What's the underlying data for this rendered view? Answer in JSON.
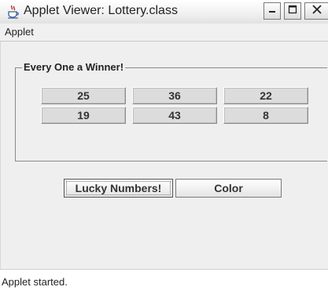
{
  "window": {
    "title": "Applet Viewer: Lottery.class"
  },
  "menubar": {
    "items": [
      "Applet"
    ]
  },
  "applet": {
    "group_title": "Every One a Winner!",
    "numbers": [
      "25",
      "36",
      "22",
      "19",
      "43",
      "8"
    ],
    "buttons": {
      "lucky": "Lucky Numbers!",
      "color": "Color"
    }
  },
  "status": {
    "text": "Applet started."
  },
  "icons": {
    "app": "java-cup-icon",
    "minimize": "minimize-icon",
    "maximize": "maximize-icon",
    "close": "close-icon"
  }
}
